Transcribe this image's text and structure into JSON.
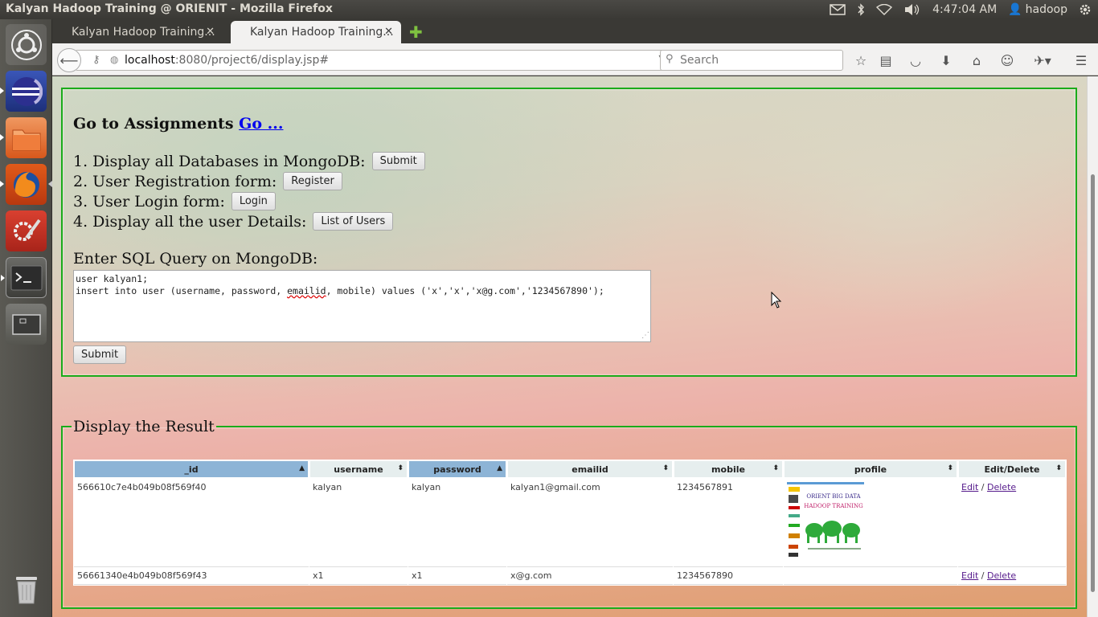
{
  "window": {
    "title": "Kalyan Hadoop Training @ ORIENIT - Mozilla Firefox"
  },
  "tray": {
    "time": "4:47:04 AM",
    "user": "hadoop"
  },
  "launcher": {
    "items": [
      "ubuntu-dash",
      "eclipse",
      "files",
      "firefox",
      "system-settings",
      "terminal",
      "workspace-switcher",
      "trash"
    ]
  },
  "browser": {
    "tabs": [
      {
        "label": "Kalyan Hadoop Training...",
        "active": false
      },
      {
        "label": "Kalyan Hadoop Training...",
        "active": true
      }
    ],
    "url_host": "localhost",
    "url_rest": ":8080/project6/display.jsp#",
    "search_placeholder": "Search"
  },
  "assignments": {
    "heading": "Go to Assignments",
    "go_link": "Go ...",
    "items": [
      {
        "text": "1. Display all Databases in MongoDB:",
        "button": "Submit"
      },
      {
        "text": "2. User Registration form:",
        "button": "Register"
      },
      {
        "text": "3. User Login form:",
        "button": "Login"
      },
      {
        "text": "4. Display all the user Details:",
        "button": "List of Users"
      }
    ],
    "sql_label": "Enter SQL Query on MongoDB:",
    "sql_line1": "user kalyan1;",
    "sql_line2_pre": "insert into user (username, password, ",
    "sql_line2_flag": "emailid",
    "sql_line2_post": ", mobile) values ('x','x','x@g.com','1234567890');",
    "sql_submit": "Submit"
  },
  "result": {
    "legend": "Display the Result",
    "columns": [
      "_id",
      "username",
      "password",
      "emailid",
      "mobile",
      "profile",
      "Edit/Delete"
    ],
    "rows": [
      {
        "id": "566610c7e4b049b08f569f40",
        "username": "kalyan",
        "password": "kalyan",
        "emailid": "kalyan1@gmail.com",
        "mobile": "1234567891",
        "profile_title1": "ORIENT BIG DATA",
        "profile_title2": "HADOOP TRAINING",
        "edit": "Edit",
        "sep": " / ",
        "delete": "Delete"
      },
      {
        "id": "56661340e4b049b08f569f43",
        "username": "x1",
        "password": "x1",
        "emailid": "x@g.com",
        "mobile": "1234567890",
        "edit": "Edit",
        "sep": " / ",
        "delete": "Delete"
      }
    ],
    "accent_sorted": "#8db4d6",
    "border_color": "#1aab1a"
  }
}
